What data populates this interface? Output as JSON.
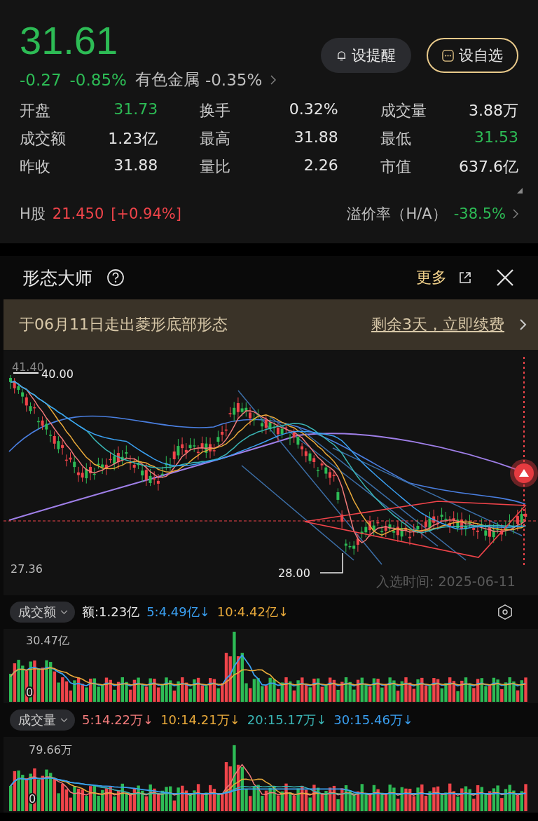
{
  "quote": {
    "price": "31.61",
    "change": "-0.27",
    "change_pct": "-0.85%",
    "sector": {
      "name": "有色金属",
      "change": "-0.35%"
    }
  },
  "buttons": [
    {
      "label": "设提醒",
      "kind": "alert"
    },
    {
      "label": "设自选",
      "kind": "watchlist"
    }
  ],
  "stats": [
    {
      "label": "开盘",
      "value": "31.73",
      "color": "#2dbb55"
    },
    {
      "label": "换手",
      "value": "0.32%",
      "color": "#e6e6e6"
    },
    {
      "label": "成交量",
      "value": "3.88万",
      "color": "#e6e6e6"
    },
    {
      "label": "成交额",
      "value": "1.23亿",
      "color": "#e6e6e6"
    },
    {
      "label": "最高",
      "value": "31.88",
      "color": "#e6e6e6"
    },
    {
      "label": "最低",
      "value": "31.53",
      "color": "#2dbb55"
    },
    {
      "label": "昨收",
      "value": "31.88",
      "color": "#e6e6e6"
    },
    {
      "label": "量比",
      "value": "2.26",
      "color": "#e6e6e6"
    },
    {
      "label": "市值",
      "value": "637.6亿",
      "color": "#e6e6e6"
    }
  ],
  "h_share": {
    "label": "H股",
    "price": "21.450",
    "change": "[+0.94%]",
    "premium_label": "溢价率（H/A）",
    "premium": "-38.5%"
  },
  "panel": {
    "title": "形态大师",
    "more": "更多"
  },
  "banner": {
    "text": "于06月11日走出菱形底部形态",
    "action": "剩余3天，立即续费"
  },
  "kline": {
    "high": "41.40",
    "high_marker": "40.00",
    "low": "27.36",
    "low_marker": "28.00",
    "entry": "入选时间: 2025-06-11"
  },
  "turnover": {
    "selector": "成交额",
    "max": "30.47亿",
    "zero": "0",
    "items": [
      {
        "text": "额:1.23亿",
        "color": "#e6e6e6"
      },
      {
        "text": "5:4.49亿↓",
        "color": "#3a9ff0"
      },
      {
        "text": "10:4.42亿↓",
        "color": "#e8a93a"
      }
    ]
  },
  "volume": {
    "selector": "成交量",
    "max": "79.66万",
    "zero": "0",
    "items": [
      {
        "text": "5:14.22万↓",
        "color": "#f07a7a"
      },
      {
        "text": "10:14.21万↓",
        "color": "#e8a93a"
      },
      {
        "text": "20:15.17万↓",
        "color": "#3ab5b5"
      },
      {
        "text": "30:15.46万↓",
        "color": "#3a9ff0"
      }
    ]
  }
}
